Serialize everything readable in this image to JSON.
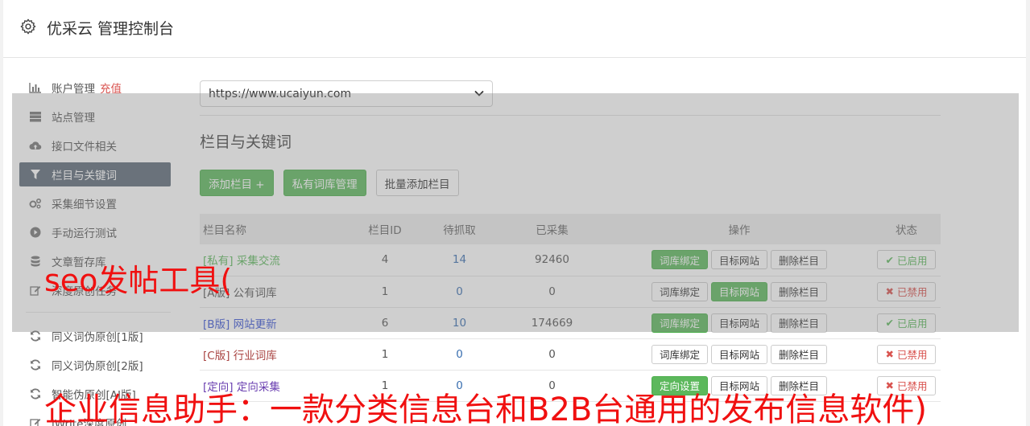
{
  "app": {
    "title": "优采云 管理控制台",
    "icon": "gear-icon"
  },
  "sidebar": {
    "items": [
      {
        "label": "账户管理",
        "extra": "充值",
        "icon": "bar-chart-icon"
      },
      {
        "label": "站点管理",
        "icon": "server-icon"
      },
      {
        "label": "接口文件相关",
        "icon": "cloud-upload-icon"
      },
      {
        "label": "栏目与关键词",
        "icon": "filter-icon",
        "active": true
      },
      {
        "label": "采集细节设置",
        "icon": "cogs-icon"
      },
      {
        "label": "手动运行测试",
        "icon": "play-icon"
      },
      {
        "label": "文章暂存库",
        "icon": "database-icon"
      },
      {
        "label": "深度原创任务",
        "icon": "edit-icon"
      }
    ],
    "items2": [
      {
        "label": "同义词伪原创[1版]",
        "icon": "refresh-icon"
      },
      {
        "label": "同义词伪原创[2版]",
        "icon": "refresh-icon"
      },
      {
        "label": "智能伪原创[AI版]",
        "icon": "refresh-icon"
      },
      {
        "label": "iWrite深度原创",
        "icon": "edit-icon"
      }
    ]
  },
  "main": {
    "site_select": "https://www.ucaiyun.com",
    "section_title": "栏目与关键词",
    "buttons": {
      "add_column": "添加栏目 +",
      "private_lib": "私有词库管理",
      "batch_add": "批量添加栏目"
    },
    "table": {
      "headers": [
        "栏目名称",
        "栏目ID",
        "待抓取",
        "已采集",
        "操作",
        "状态"
      ],
      "rows": [
        {
          "tag": "[私有]",
          "name": "采集交流",
          "id": "4",
          "pending": "14",
          "collected": "92460",
          "ops": [
            "词库绑定",
            "目标网站",
            "删除栏目"
          ],
          "status": "已启用"
        },
        {
          "tag": "[A版]",
          "name": "公有词库",
          "id": "1",
          "pending": "0",
          "collected": "0",
          "ops": [
            "词库绑定",
            "目标网站",
            "删除栏目"
          ],
          "status": "已禁用"
        },
        {
          "tag": "[B版]",
          "name": "网站更新",
          "id": "6",
          "pending": "10",
          "collected": "174669",
          "ops": [
            "词库绑定",
            "目标网站",
            "删除栏目"
          ],
          "status": "已启用"
        },
        {
          "tag": "[C版]",
          "name": "行业词库",
          "id": "1",
          "pending": "0",
          "collected": "0",
          "ops": [
            "词库绑定",
            "目标网站",
            "删除栏目"
          ],
          "status": "已禁用"
        },
        {
          "tag": "[定向]",
          "name": "定向采集",
          "id": "1",
          "pending": "0",
          "collected": "0",
          "ops": [
            "定向设置",
            "目标网站",
            "删除栏目"
          ],
          "status": "已禁用"
        }
      ]
    }
  },
  "watermark": {
    "line1": "seo发帖工具(",
    "line2": "企业信息助手：一款分类信息台和B2B台通用的发布信息软件)"
  },
  "colors": {
    "green": "#5cb85c",
    "red": "#d9534f",
    "overlay_red": "#f01010"
  }
}
